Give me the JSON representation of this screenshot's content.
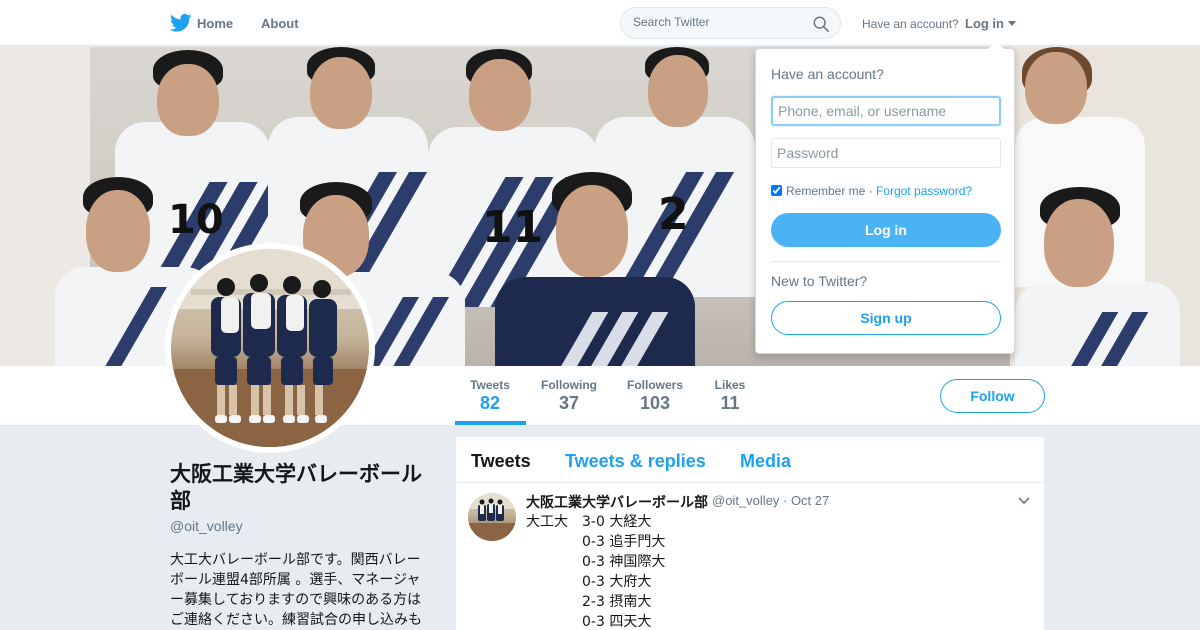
{
  "nav": {
    "home_label": "Home",
    "about_label": "About",
    "search_placeholder": "Search Twitter",
    "have_account": "Have an account?",
    "login_label": "Log in"
  },
  "profile": {
    "name": "大阪工業大学バレーボール部",
    "handle": "@oit_volley",
    "bio": "大工大バレーボール部です。関西バレーボール連盟4部所属 。選手、マネージャー募集しておりますので興味のある方はご連絡ください。練習試合の申し込みも"
  },
  "stats": [
    {
      "label": "Tweets",
      "value": "82",
      "active": true
    },
    {
      "label": "Following",
      "value": "37",
      "active": false
    },
    {
      "label": "Followers",
      "value": "103",
      "active": false
    },
    {
      "label": "Likes",
      "value": "11",
      "active": false
    }
  ],
  "follow_label": "Follow",
  "timeline": {
    "tabs": [
      "Tweets",
      "Tweets & replies",
      "Media"
    ],
    "tweet": {
      "name": "大阪工業大学バレーボール部",
      "handle_date": "@oit_volley · Oct 27",
      "rows": [
        {
          "team": "大工大",
          "result": "3-0  大経大"
        },
        {
          "team": "",
          "result": "0-3 追手門大"
        },
        {
          "team": "",
          "result": "0-3 神国際大"
        },
        {
          "team": "",
          "result": "0-3 大府大"
        },
        {
          "team": "",
          "result": "2-3 摂南大"
        },
        {
          "team": "",
          "result": "0-3 四天大"
        }
      ]
    }
  },
  "login_dropdown": {
    "title": "Have an account?",
    "username_placeholder": "Phone, email, or username",
    "password_placeholder": "Password",
    "remember_me": "Remember me",
    "separator": " · ",
    "forgot_password": "Forgot password?",
    "login_button": "Log in",
    "new_to_twitter": "New to Twitter?",
    "signup_button": "Sign up"
  },
  "colors": {
    "accent": "#1da1f2",
    "login_button": "#4ab3f4",
    "background": "#e6ecf0"
  }
}
